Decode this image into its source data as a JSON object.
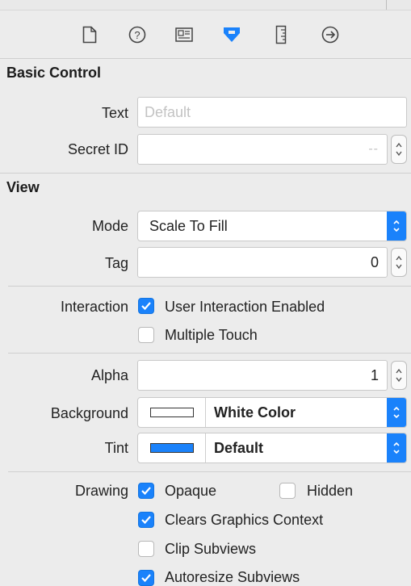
{
  "inspector": {
    "tabs": [
      "file-icon",
      "help-icon",
      "identity-icon",
      "attributes-icon",
      "size-icon",
      "connections-icon"
    ],
    "accent_color": "#1a82fb"
  },
  "basic_control": {
    "title": "Basic Control",
    "text_label": "Text",
    "text_placeholder": "Default",
    "secret_id_label": "Secret ID",
    "secret_id_value": "--"
  },
  "view": {
    "title": "View",
    "mode_label": "Mode",
    "mode_value": "Scale To Fill",
    "tag_label": "Tag",
    "tag_value": "0",
    "interaction_label": "Interaction",
    "user_interaction_label": "User Interaction Enabled",
    "user_interaction_checked": true,
    "multiple_touch_label": "Multiple Touch",
    "multiple_touch_checked": false,
    "alpha_label": "Alpha",
    "alpha_value": "1",
    "background_label": "Background",
    "background_value": "White Color",
    "background_swatch": "#ffffff",
    "tint_label": "Tint",
    "tint_value": "Default",
    "tint_swatch": "#1a82fb",
    "drawing_label": "Drawing",
    "opaque_label": "Opaque",
    "opaque_checked": true,
    "hidden_label": "Hidden",
    "hidden_checked": false,
    "clears_label": "Clears Graphics Context",
    "clears_checked": true,
    "clip_label": "Clip Subviews",
    "clip_checked": false,
    "autoresize_label": "Autoresize Subviews",
    "autoresize_checked": true
  }
}
